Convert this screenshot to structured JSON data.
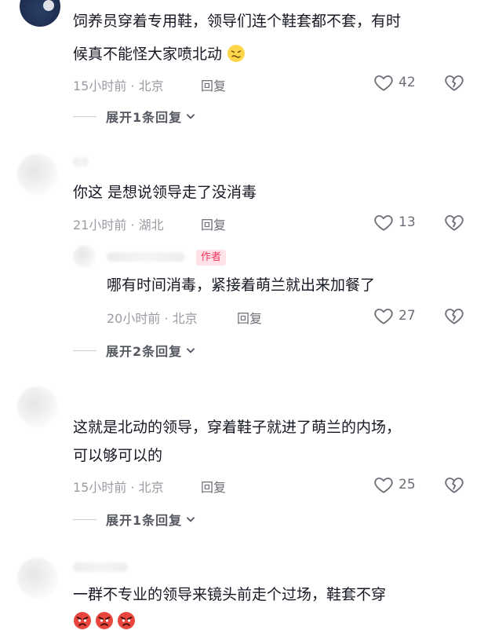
{
  "comments": [
    {
      "text_line1": "饲养员穿着专用鞋，领导们连个鞋套都不套，有时",
      "text_line2": "候真不能怪大家喷北动",
      "meta": "15小时前 · 北京",
      "reply_label": "回复",
      "likes": "42",
      "expand_label": "展开1条回复"
    },
    {
      "text_line1": "你这 是想说领导走了没消毒",
      "meta": "21小时前 · 湖北",
      "reply_label": "回复",
      "likes": "13",
      "sub_reply": {
        "author_tag": "作者",
        "text_line1": "哪有时间消毒，紧接着萌兰就出来加餐了",
        "meta": "20小时前 · 北京",
        "reply_label": "回复",
        "likes": "27"
      },
      "expand_label": "展开2条回复"
    },
    {
      "text_line1": "这就是北动的领导，穿着鞋子就进了萌兰的内场，",
      "text_line2": "可以够可以的",
      "meta": "15小时前 · 北京",
      "reply_label": "回复",
      "likes": "25",
      "expand_label": "展开1条回复"
    },
    {
      "text_line1": "一群不专业的领导来镜头前走个过场，鞋套不穿"
    }
  ],
  "icons": {
    "like": "heart-outline-icon",
    "dislike": "broken-heart-icon",
    "chevron": "chevron-down-icon",
    "emoji_sick": "sick-face-emoji",
    "emoji_angry": "angry-face-emoji"
  },
  "colors": {
    "text": "#161823",
    "meta": "#9a9ca3",
    "author_tag_bg": "#fde3e8",
    "author_tag_text": "#f2375c"
  }
}
